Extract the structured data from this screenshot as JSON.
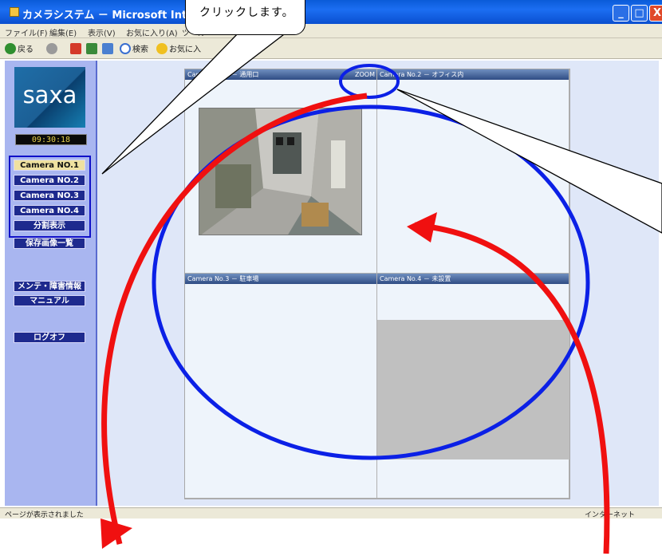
{
  "window": {
    "title": "カメラシステム － Microsoft Internet",
    "min": "_",
    "max": "□",
    "close": "X"
  },
  "menubar": [
    "ファイル(F)",
    "編集(E)",
    "表示(V)",
    "お気に入り(A)",
    "ツール"
  ],
  "toolbar": {
    "back": "戻る",
    "search": "検索",
    "favorites": "お気に入"
  },
  "callout": "クリックします。",
  "sidebar": {
    "logo": "saxa",
    "clock": "09:30:18",
    "buttons": [
      "Camera NO.1",
      "Camera NO.2",
      "Camera NO.3",
      "Camera NO.4",
      "分割表示",
      "保存画像一覧",
      "メンテ・障害情報",
      "マニュアル",
      "ログオフ"
    ]
  },
  "cameras": [
    {
      "title": "Camera No.1 － 通用口",
      "zoom": "ZOOM"
    },
    {
      "title": "Camera No.2 － オフィス内"
    },
    {
      "title": "Camera No.3 － 駐車場"
    },
    {
      "title": "Camera No.4 － 未設置"
    }
  ],
  "statusbar": {
    "text": "ページが表示されました",
    "zone": "インターネット"
  },
  "colors": {
    "highlight_blue": "#1010c8",
    "arrow_red": "#f01010",
    "nav_button": "#1e2a8e",
    "active_button": "#efe1a0"
  }
}
